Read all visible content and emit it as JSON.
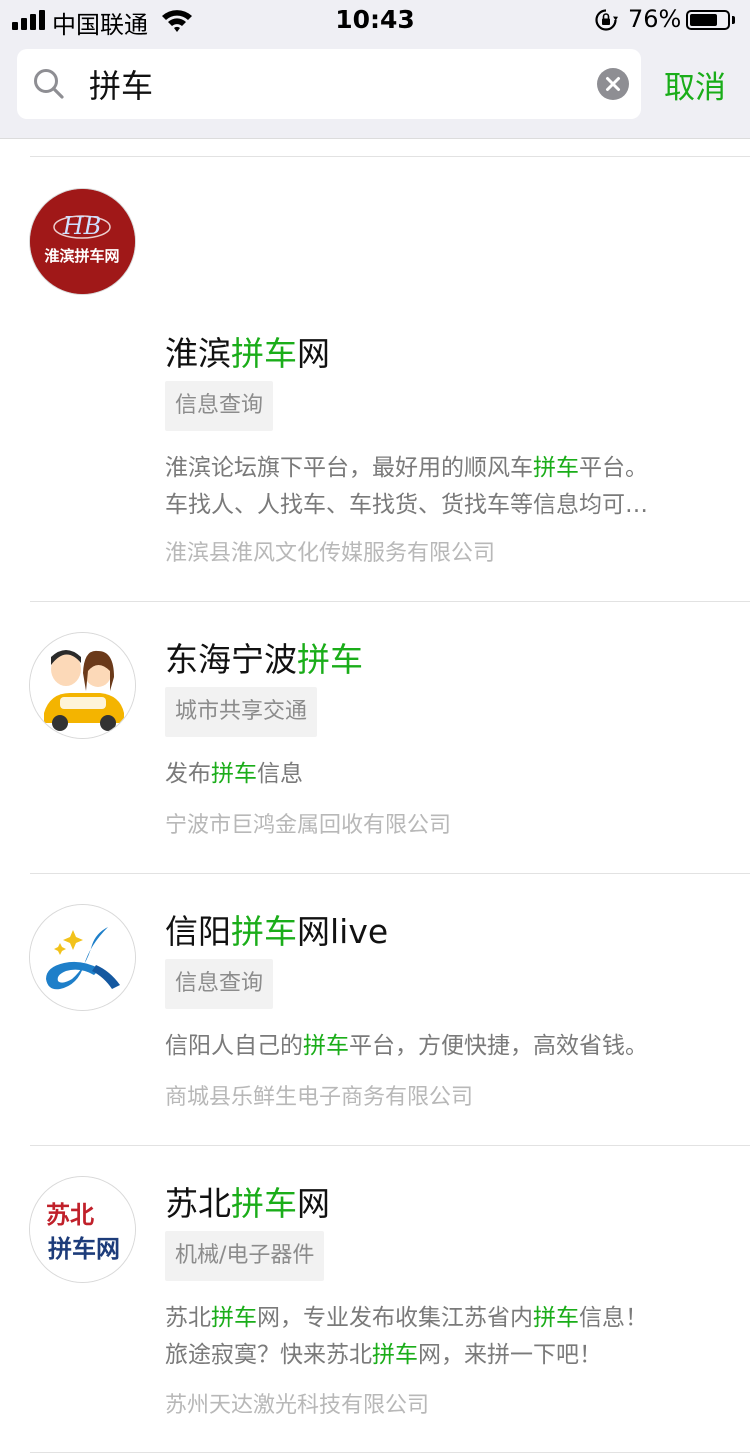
{
  "status_bar": {
    "carrier": "中国联通",
    "time": "10:43",
    "battery_percent": "76%",
    "battery_level": 0.76
  },
  "search": {
    "query": "拼车",
    "cancel_label": "取消"
  },
  "accent_color": "#1aad19",
  "results": [
    {
      "name_parts": [
        "淮滨",
        "拼车",
        "网"
      ],
      "avatar_text": "淮滨拼车网",
      "avatar_logo": "HB",
      "tag": "信息查询",
      "desc_line1": [
        "淮滨论坛旗下平台，最好用的顺风车",
        "拼车",
        "平台。"
      ],
      "desc_line2": "车找人、人找车、车找货、货找车等信息均可…",
      "company": "淮滨县淮风文化传媒服务有限公司"
    },
    {
      "name_parts": [
        "东海宁波",
        "拼车",
        ""
      ],
      "tag": "城市共享交通",
      "desc_line1": [
        "发布",
        "拼车",
        "信息"
      ],
      "company": "宁波市巨鸿金属回收有限公司"
    },
    {
      "name_parts": [
        "信阳",
        "拼车",
        "网live"
      ],
      "tag": "信息查询",
      "desc_line1": [
        "信阳人自己的",
        "拼车",
        "平台，方便快捷，高效省钱。"
      ],
      "company": "商城县乐鲜生电子商务有限公司"
    },
    {
      "name_parts": [
        "苏北",
        "拼车",
        "网"
      ],
      "avatar_text_1": "苏北",
      "avatar_text_2": "拼车网",
      "tag": "机械/电子器件",
      "desc_line1": [
        "苏北",
        "拼车",
        "网，专业发布收集江苏省内",
        "拼车",
        "信息！"
      ],
      "desc_line2": [
        "旅途寂寞？快来苏北",
        "拼车",
        "网，来拼一下吧！"
      ],
      "company": "苏州天达激光科技有限公司"
    }
  ]
}
